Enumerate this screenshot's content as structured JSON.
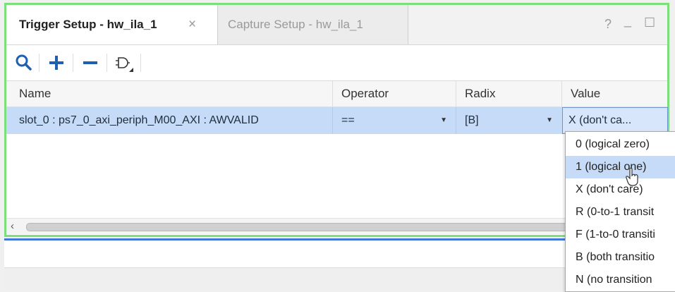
{
  "tabs": [
    {
      "label": "Trigger Setup - hw_ila_1",
      "active": true,
      "close": "×"
    },
    {
      "label": "Capture Setup - hw_ila_1",
      "active": false
    }
  ],
  "window_controls": {
    "help": "?",
    "minimize": "_",
    "maximize": "☐"
  },
  "toolbar": {
    "icons": [
      "search-icon",
      "plus-icon",
      "minus-icon",
      "logic-gate-icon"
    ]
  },
  "table": {
    "columns": [
      "Name",
      "Operator",
      "Radix",
      "Value"
    ],
    "row": {
      "name": "slot_0 : ps7_0_axi_periph_M00_AXI : AWVALID",
      "operator": "==",
      "radix": "[B]",
      "value": "X (don't ca..."
    }
  },
  "dropdown": {
    "options": [
      "0 (logical zero)",
      "1 (logical one)",
      "X (don't care)",
      "R (0-to-1 transit",
      "F (1-to-0 transiti",
      "B (both transitio",
      "N (no transition"
    ],
    "highlighted_index": 1
  },
  "colors": {
    "panel_border": "#7be07b",
    "selection": "#c6dbf7",
    "lower_border": "#3e7ad6",
    "toolbar_icon": "#1e5fb3"
  }
}
